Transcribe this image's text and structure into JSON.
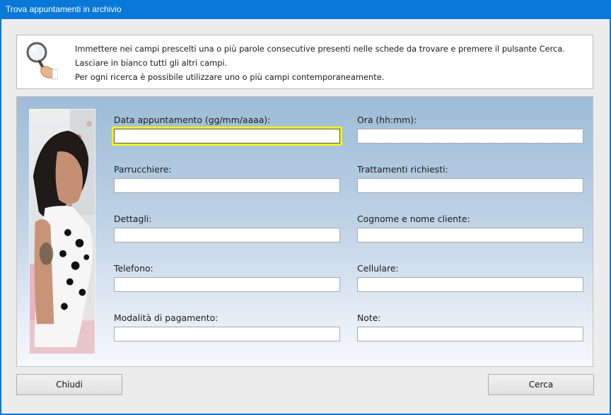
{
  "window": {
    "title": "Trova appuntamenti in archivio"
  },
  "info": {
    "icon": "magnifier-hand-icon",
    "lines": [
      "Immettere nei campi prescelti una o più parole consecutive presenti nelle schede da trovare e premere il pulsante Cerca.",
      "Lasciare in bianco tutti gli altri campi.",
      "Per ogni ricerca è possibile utilizzare uno o più campi contemporaneamente."
    ]
  },
  "form": {
    "fields": [
      {
        "label": "Data appuntamento (gg/mm/aaaa):",
        "value": ""
      },
      {
        "label": "Ora (hh:mm):",
        "value": ""
      },
      {
        "label": "Parrucchiere:",
        "value": ""
      },
      {
        "label": "Trattamenti richiesti:",
        "value": ""
      },
      {
        "label": "Dettagli:",
        "value": ""
      },
      {
        "label": "Cognome e nome cliente:",
        "value": ""
      },
      {
        "label": "Telefono:",
        "value": ""
      },
      {
        "label": "Cellulare:",
        "value": ""
      },
      {
        "label": "Modalità di pagamento:",
        "value": ""
      },
      {
        "label": "Note:",
        "value": ""
      }
    ]
  },
  "buttons": {
    "close": "Chiudi",
    "search": "Cerca"
  },
  "colors": {
    "titlebar": "#0a78d7",
    "focus_highlight": "#f4f01c"
  }
}
